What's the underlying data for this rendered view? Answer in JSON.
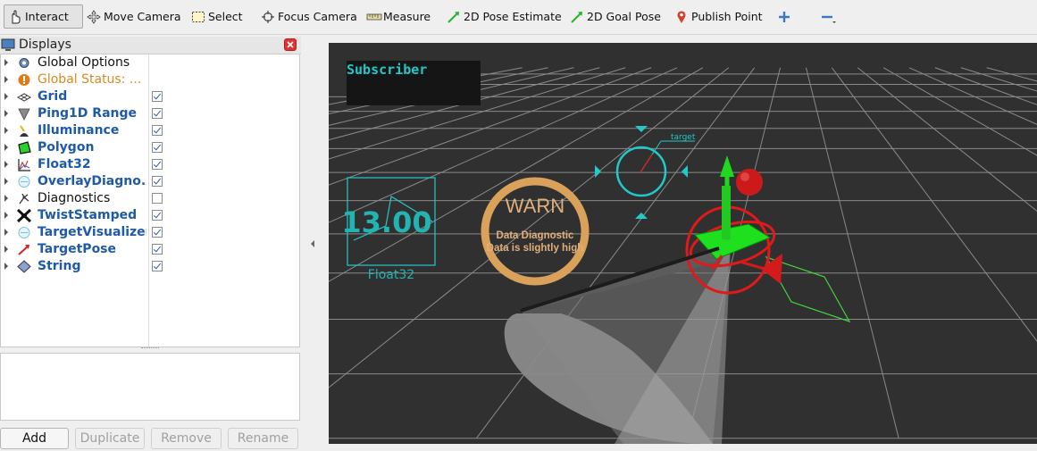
{
  "toolbar": {
    "interact": "Interact",
    "move_camera": "Move Camera",
    "select": "Select",
    "focus_camera": "Focus Camera",
    "measure": "Measure",
    "pose_estimate": "2D Pose Estimate",
    "goal_pose": "2D Goal Pose",
    "publish_point": "Publish Point"
  },
  "displays": {
    "title": "Displays",
    "items": [
      {
        "label": "Global Options",
        "icon": "gear-icon",
        "checked": null
      },
      {
        "label": "Global Status: ...",
        "icon": "warning-icon",
        "checked": null
      },
      {
        "label": "Grid",
        "icon": "grid-icon",
        "checked": true
      },
      {
        "label": "Ping1D Range",
        "icon": "range-cone-icon",
        "checked": true
      },
      {
        "label": "Illuminance",
        "icon": "lamp-icon",
        "checked": true
      },
      {
        "label": "Polygon",
        "icon": "polygon-icon",
        "checked": true
      },
      {
        "label": "Float32",
        "icon": "plot-icon",
        "checked": true
      },
      {
        "label": "OverlayDiagno...",
        "icon": "overlay-icon",
        "checked": true
      },
      {
        "label": "Diagnostics",
        "icon": "diagnostics-icon",
        "checked": false
      },
      {
        "label": "TwistStamped",
        "icon": "twist-icon",
        "checked": true
      },
      {
        "label": "TargetVisualizer",
        "icon": "overlay-icon",
        "checked": true
      },
      {
        "label": "TargetPose",
        "icon": "arrow-icon",
        "checked": true
      },
      {
        "label": "String",
        "icon": "diamond-icon",
        "checked": true
      }
    ]
  },
  "buttons": {
    "add": "Add",
    "duplicate": "Duplicate",
    "remove": "Remove",
    "rename": "Rename"
  },
  "viewport": {
    "subscriber_text": "Subscriber",
    "float_value": "13.00",
    "float_label": "Float32",
    "diag_status": "WARN",
    "diag_line1": "Data Diagnostic",
    "diag_line2": "Data is slightly high",
    "target_label": "target"
  },
  "colors": {
    "viewport_bg": "#303030",
    "cyan": "#22c9c9",
    "warn_orange": "#d9a15a",
    "display_blue": "#1e5aa8"
  }
}
